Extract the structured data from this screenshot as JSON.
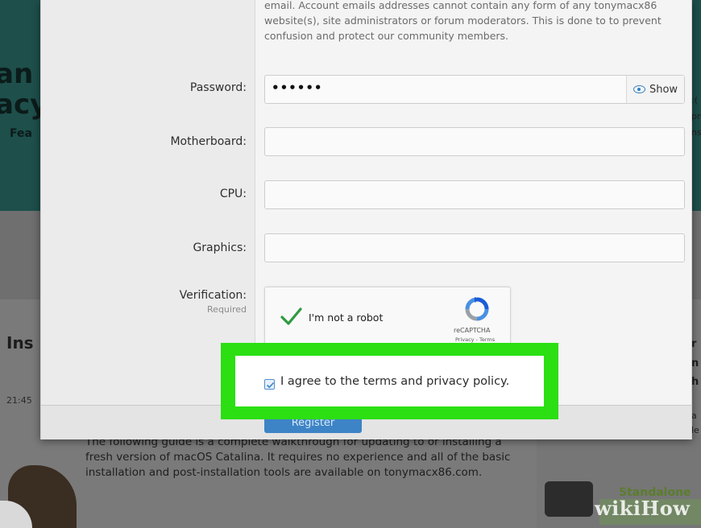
{
  "background": {
    "hero_line1": "an",
    "hero_line2": "acy",
    "hero_line3": "Fea",
    "section_title": "Ins",
    "timestamp": "21:45",
    "right_fragments": [
      ":(",
      "pr",
      "ns"
    ],
    "right_fragments_lower": [
      "r",
      "n",
      "h",
      "a",
      "le"
    ],
    "article_text": "The following guide is a complete walkthrough for updating to or installing a fresh version of macOS Catalina. It requires no experience and all of the basic installation and post-installation tools are available on tonymacx86.com.",
    "sidebar_caption": "Standalone"
  },
  "form": {
    "email_hint": "email. Account emails addresses cannot contain any form of any tonymacx86 website(s), site administrators or forum moderators. This is done to to prevent confusion and protect our community members.",
    "password": {
      "label": "Password:",
      "value": "••••••",
      "show_label": "Show"
    },
    "motherboard": {
      "label": "Motherboard:",
      "value": ""
    },
    "cpu": {
      "label": "CPU:",
      "value": ""
    },
    "graphics": {
      "label": "Graphics:",
      "value": ""
    },
    "verification": {
      "label": "Verification:",
      "sublabel": "Required",
      "captcha_label": "I'm not a robot",
      "captcha_brand": "reCAPTCHA",
      "captcha_links": "Privacy - Terms",
      "checked": true
    },
    "agree": {
      "label": "I agree to the terms and privacy policy.",
      "checked": true
    },
    "register_label": "Register"
  },
  "watermark": {
    "wiki": "wiki",
    "how": "How"
  },
  "colors": {
    "highlight": "#2bdf13",
    "primary_button": "#3d84c6",
    "checkmark": "#2e9a3f",
    "link_blue": "#2f7fc4"
  },
  "icons": [
    "eye-icon",
    "checkmark-icon",
    "recaptcha-logo-icon",
    "checkbox-checked-icon"
  ]
}
